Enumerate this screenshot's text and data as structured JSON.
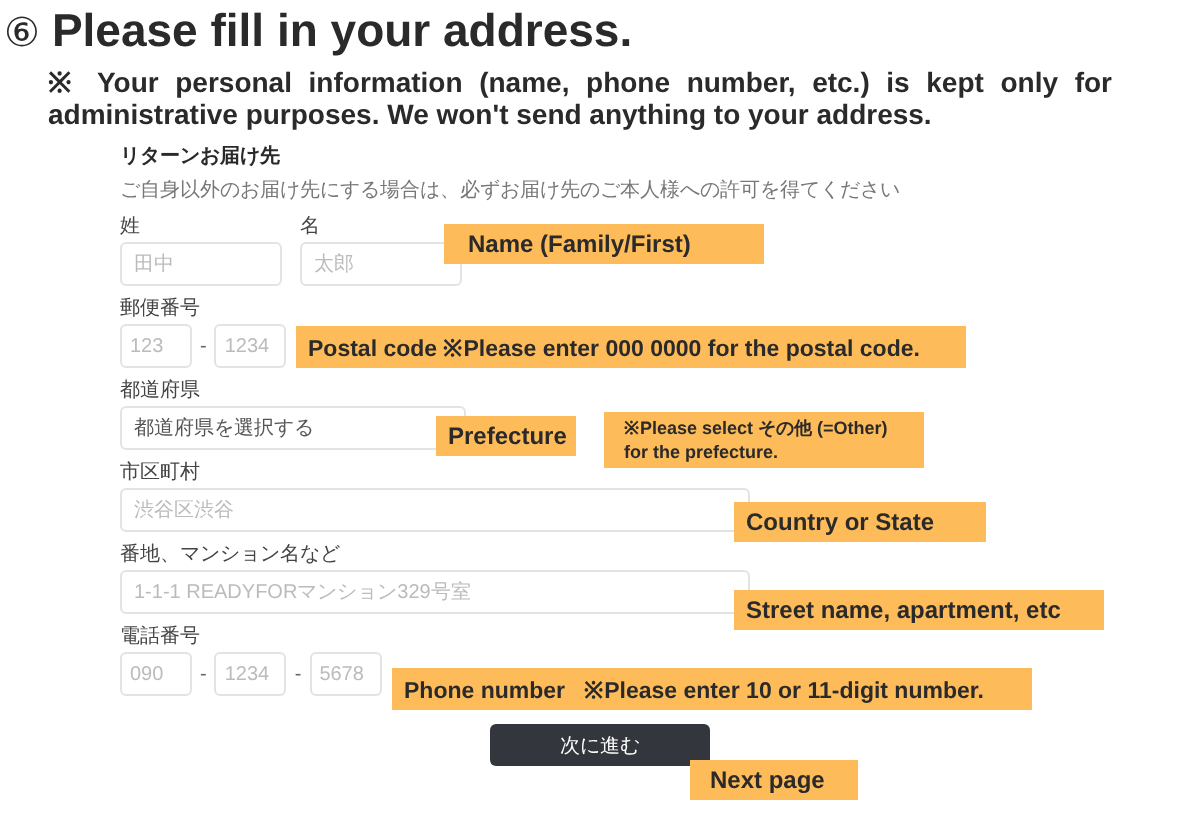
{
  "heading": {
    "step": "⑥",
    "title": "Please fill in your address."
  },
  "notice": "※ Your personal information (name, phone number, etc.) is kept only for administrative purposes. We won't send anything to your address.",
  "form": {
    "title": "リターンお届け先",
    "description": "ご自身以外のお届け先にする場合は、必ずお届け先のご本人様への許可を得てください",
    "rows": [
      {
        "groups": [
          {
            "label": "姓",
            "parts": [
              {
                "kind": "input",
                "placeholder": "田中"
              }
            ]
          },
          {
            "label": "名",
            "parts": [
              {
                "kind": "input",
                "placeholder": "太郎"
              }
            ]
          }
        ]
      },
      {
        "groups": [
          {
            "label": "郵便番号",
            "parts": [
              {
                "kind": "input",
                "placeholder": "123"
              },
              {
                "kind": "separator",
                "text": "-"
              },
              {
                "kind": "input",
                "placeholder": "1234"
              }
            ]
          }
        ]
      },
      {
        "groups": [
          {
            "label": "都道府県",
            "parts": [
              {
                "kind": "select",
                "value": "都道府県を選択する"
              }
            ]
          }
        ]
      },
      {
        "groups": [
          {
            "label": "市区町村",
            "parts": [
              {
                "kind": "input",
                "placeholder": "渋谷区渋谷"
              }
            ]
          }
        ]
      },
      {
        "groups": [
          {
            "label": "番地、マンション名など",
            "parts": [
              {
                "kind": "input",
                "placeholder": "1-1-1 READYFORマンション329号室"
              }
            ]
          }
        ]
      },
      {
        "groups": [
          {
            "label": "電話番号",
            "parts": [
              {
                "kind": "input",
                "placeholder": "090"
              },
              {
                "kind": "separator",
                "text": "-"
              },
              {
                "kind": "input",
                "placeholder": "1234"
              },
              {
                "kind": "separator",
                "text": "-"
              },
              {
                "kind": "input",
                "placeholder": "5678"
              }
            ]
          }
        ]
      }
    ],
    "button": "次に進む"
  },
  "annotations": [
    {
      "text": "Name (Family/First)"
    },
    {
      "text": "Postal code  ※Please enter 000 0000 for the postal code."
    },
    {
      "text": "Prefecture"
    },
    {
      "text": "※Please select その他 (=Other) for the prefecture."
    },
    {
      "text": "Country or State"
    },
    {
      "text": "Street name, apartment, etc"
    },
    {
      "text": "Phone number   ※Please enter 10 or 11-digit number."
    },
    {
      "text": "Next page"
    }
  ]
}
